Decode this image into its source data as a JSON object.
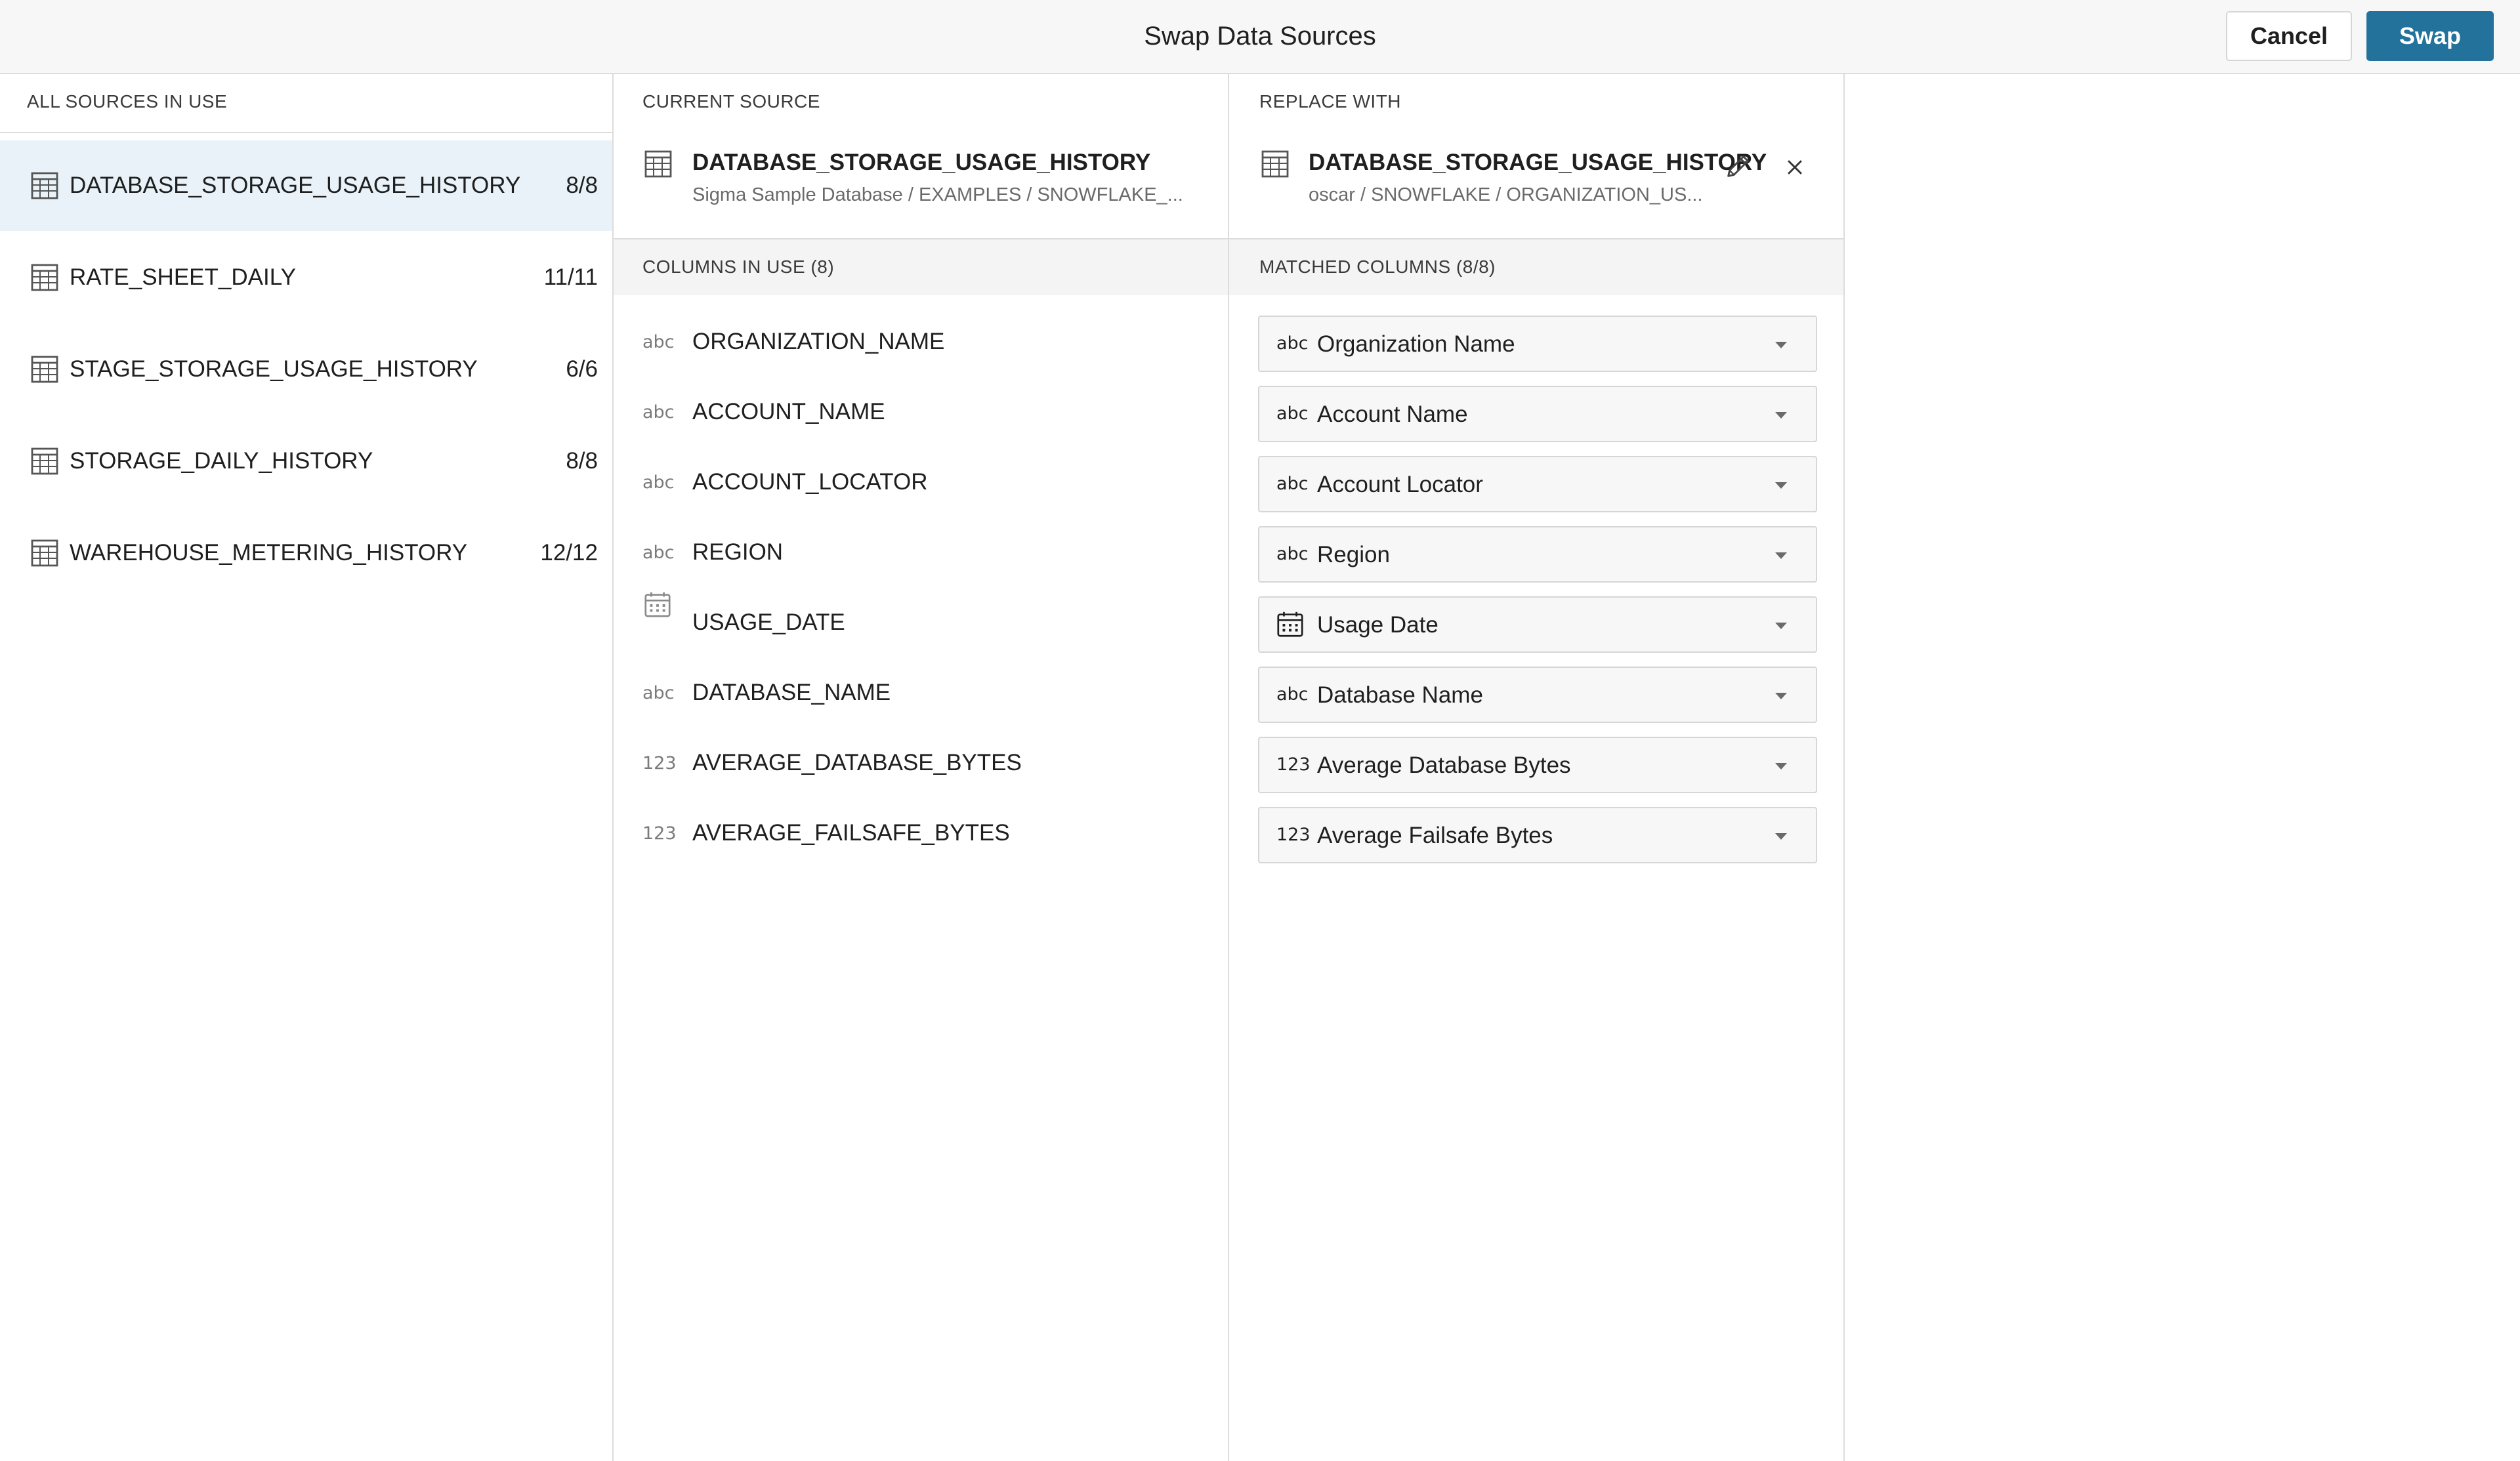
{
  "header": {
    "title": "Swap Data Sources",
    "cancel_label": "Cancel",
    "swap_label": "Swap"
  },
  "colors": {
    "primary": "#23729c",
    "selected_row_bg": "#e8f2f8",
    "border": "#dcdcdc"
  },
  "sources_panel": {
    "heading": "ALL SOURCES IN USE",
    "items": [
      {
        "name": "DATABASE_STORAGE_USAGE_HISTORY",
        "count": "8/8",
        "icon": "table-icon",
        "selected": true
      },
      {
        "name": "RATE_SHEET_DAILY",
        "count": "11/11",
        "icon": "table-icon"
      },
      {
        "name": "STAGE_STORAGE_USAGE_HISTORY",
        "count": "6/6",
        "icon": "table-icon"
      },
      {
        "name": "STORAGE_DAILY_HISTORY",
        "count": "8/8",
        "icon": "table-icon"
      },
      {
        "name": "WAREHOUSE_METERING_HISTORY",
        "count": "12/12",
        "icon": "table-icon"
      }
    ]
  },
  "current_source": {
    "heading": "CURRENT SOURCE",
    "name": "DATABASE_STORAGE_USAGE_HISTORY",
    "path": "Sigma Sample Database / EXAMPLES / SNOWFLAKE_...",
    "columns_heading": "COLUMNS IN USE (8)",
    "columns": [
      {
        "type": "abc",
        "name": "ORGANIZATION_NAME"
      },
      {
        "type": "abc",
        "name": "ACCOUNT_NAME"
      },
      {
        "type": "abc",
        "name": "ACCOUNT_LOCATOR"
      },
      {
        "type": "abc",
        "name": "REGION"
      },
      {
        "type": "date",
        "name": "USAGE_DATE"
      },
      {
        "type": "abc",
        "name": "DATABASE_NAME"
      },
      {
        "type": "123",
        "name": "AVERAGE_DATABASE_BYTES"
      },
      {
        "type": "123",
        "name": "AVERAGE_FAILSAFE_BYTES"
      }
    ]
  },
  "replace_with": {
    "heading": "REPLACE WITH",
    "name": "DATABASE_STORAGE_USAGE_HISTORY",
    "path": "oscar / SNOWFLAKE / ORGANIZATION_US...",
    "edit_icon": "pencil-icon",
    "remove_icon": "close-icon",
    "matched_heading": "MATCHED COLUMNS (8/8)",
    "matched": [
      {
        "type": "abc",
        "name": "Organization Name"
      },
      {
        "type": "abc",
        "name": "Account Name"
      },
      {
        "type": "abc",
        "name": "Account Locator"
      },
      {
        "type": "abc",
        "name": "Region"
      },
      {
        "type": "date",
        "name": "Usage Date"
      },
      {
        "type": "abc",
        "name": "Database Name"
      },
      {
        "type": "123",
        "name": "Average Database Bytes"
      },
      {
        "type": "123",
        "name": "Average Failsafe Bytes"
      }
    ]
  }
}
